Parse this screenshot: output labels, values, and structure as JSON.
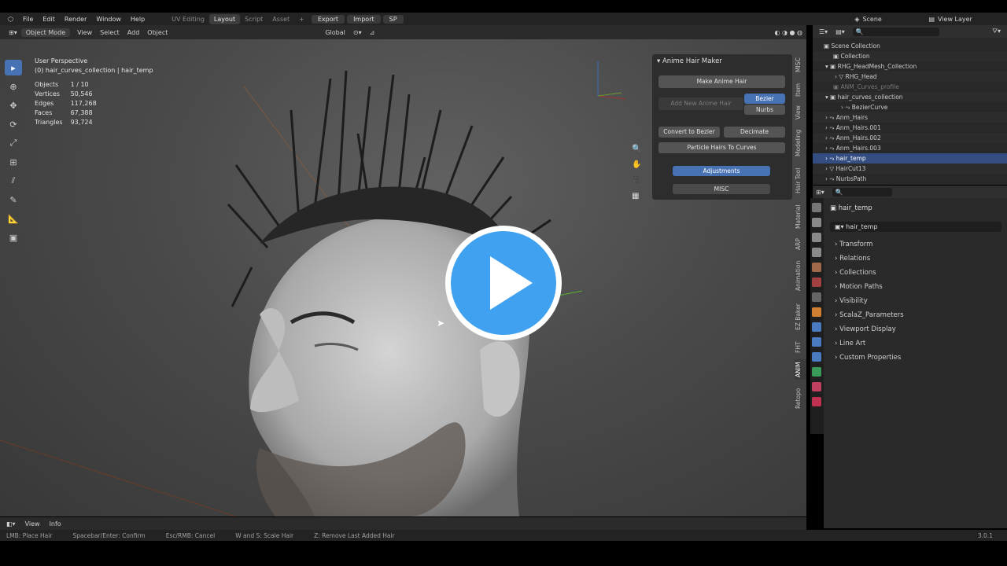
{
  "topbar": {
    "menus": [
      "File",
      "Edit",
      "Render",
      "Window",
      "Help"
    ],
    "workspaces": [
      "UV Editing",
      "Layout",
      "Script",
      "Asset"
    ],
    "active_workspace": "Layout",
    "buttons": [
      "Export",
      "Import",
      "SP"
    ],
    "scene": "Scene",
    "view_layer": "View Layer"
  },
  "viewport_header": {
    "mode": "Object Mode",
    "menus": [
      "View",
      "Select",
      "Add",
      "Object"
    ],
    "orientation": "Global"
  },
  "overlay": {
    "perspective": "User Perspective",
    "context": "(0) hair_curves_collection | hair_temp",
    "stats": [
      [
        "Objects",
        "1 / 10"
      ],
      [
        "Vertices",
        "50,546"
      ],
      [
        "Edges",
        "117,268"
      ],
      [
        "Faces",
        "67,388"
      ],
      [
        "Triangles",
        "93,724"
      ]
    ]
  },
  "hair_panel": {
    "title": "Anime Hair Maker",
    "make": "Make Anime Hair",
    "add_new": "Add New Anime Hair",
    "bezier": "Bezier",
    "nurbs": "Nurbs",
    "convert": "Convert to Bezier",
    "decimate": "Decimate",
    "particle": "Particle Hairs To Curves",
    "adjustments": "Adjustments",
    "misc": "MISC"
  },
  "side_tabs": [
    "MISC",
    "Item",
    "View",
    "Modeling",
    "Hair Tool",
    "Material",
    "ARP",
    "Animation",
    "EZ Baker",
    "FHT",
    "ANIM",
    "Retopo"
  ],
  "outliner": {
    "title": "Scene Collection",
    "rows": [
      "Collection",
      "RHG_HeadMesh_Collection",
      "RHG_Head",
      "ANM_Curves_profile",
      "hair_curves_collection",
      "BezierCurve",
      "Anm_Hairs",
      "Anm_Hairs.001",
      "Anm_Hairs.002",
      "Anm_Hairs.003",
      "hair_temp",
      "HairCut13",
      "NurbsPath"
    ]
  },
  "properties": {
    "object": "hair_temp",
    "name_field": "hair_temp",
    "sections": [
      "Transform",
      "Relations",
      "Collections",
      "Motion Paths",
      "Visibility",
      "ScalaZ_Parameters",
      "Viewport Display",
      "Line Art",
      "Custom Properties"
    ]
  },
  "footer": {
    "menus": [
      "View",
      "Info"
    ]
  },
  "status": {
    "items": [
      "LMB: Place Hair",
      "Spacebar/Enter: Confirm",
      "Esc/RMB: Cancel",
      "W and S: Scale Hair",
      "Z: Remove Last Added Hair"
    ],
    "version": "3.0.1"
  },
  "colors": {
    "accent": "#4772b3",
    "play": "#3fa1ef"
  }
}
